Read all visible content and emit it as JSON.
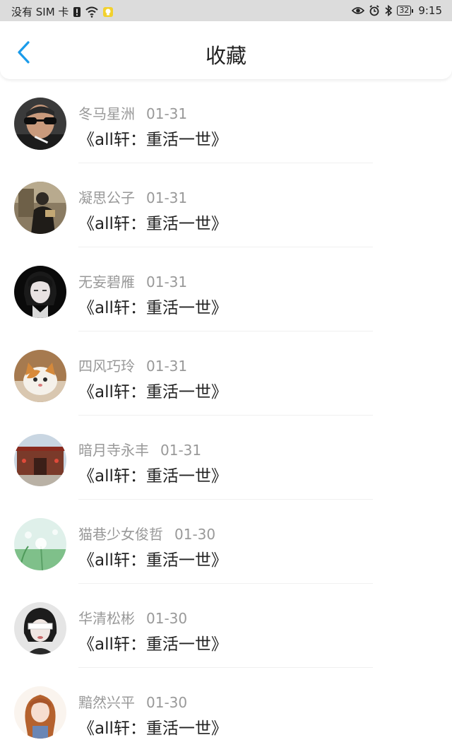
{
  "status_bar": {
    "carrier": "没有 SIM 卡",
    "time": "9:15",
    "battery": "32",
    "icons": [
      "sim-alert-icon",
      "wifi-icon",
      "notification-icon",
      "eye-icon",
      "alarm-icon",
      "bluetooth-icon",
      "battery-icon"
    ]
  },
  "header": {
    "title": "收藏",
    "back_icon": "chevron-left-icon",
    "accent_color": "#1a9bea"
  },
  "favorites": [
    {
      "user": "冬马星洲",
      "date": "01-31",
      "title": "《all轩：重活一世》"
    },
    {
      "user": "凝思公子",
      "date": "01-31",
      "title": "《all轩：重活一世》"
    },
    {
      "user": "无妄碧雁",
      "date": "01-31",
      "title": "《all轩：重活一世》"
    },
    {
      "user": "四风巧玲",
      "date": "01-31",
      "title": "《all轩：重活一世》"
    },
    {
      "user": "暗月寺永丰",
      "date": "01-31",
      "title": "《all轩：重活一世》"
    },
    {
      "user": "猫巷少女俊哲",
      "date": "01-30",
      "title": "《all轩：重活一世》"
    },
    {
      "user": "华清松彬",
      "date": "01-30",
      "title": "《all轩：重活一世》"
    },
    {
      "user": "黯然兴平",
      "date": "01-30",
      "title": "《all轩：重活一世》"
    }
  ]
}
